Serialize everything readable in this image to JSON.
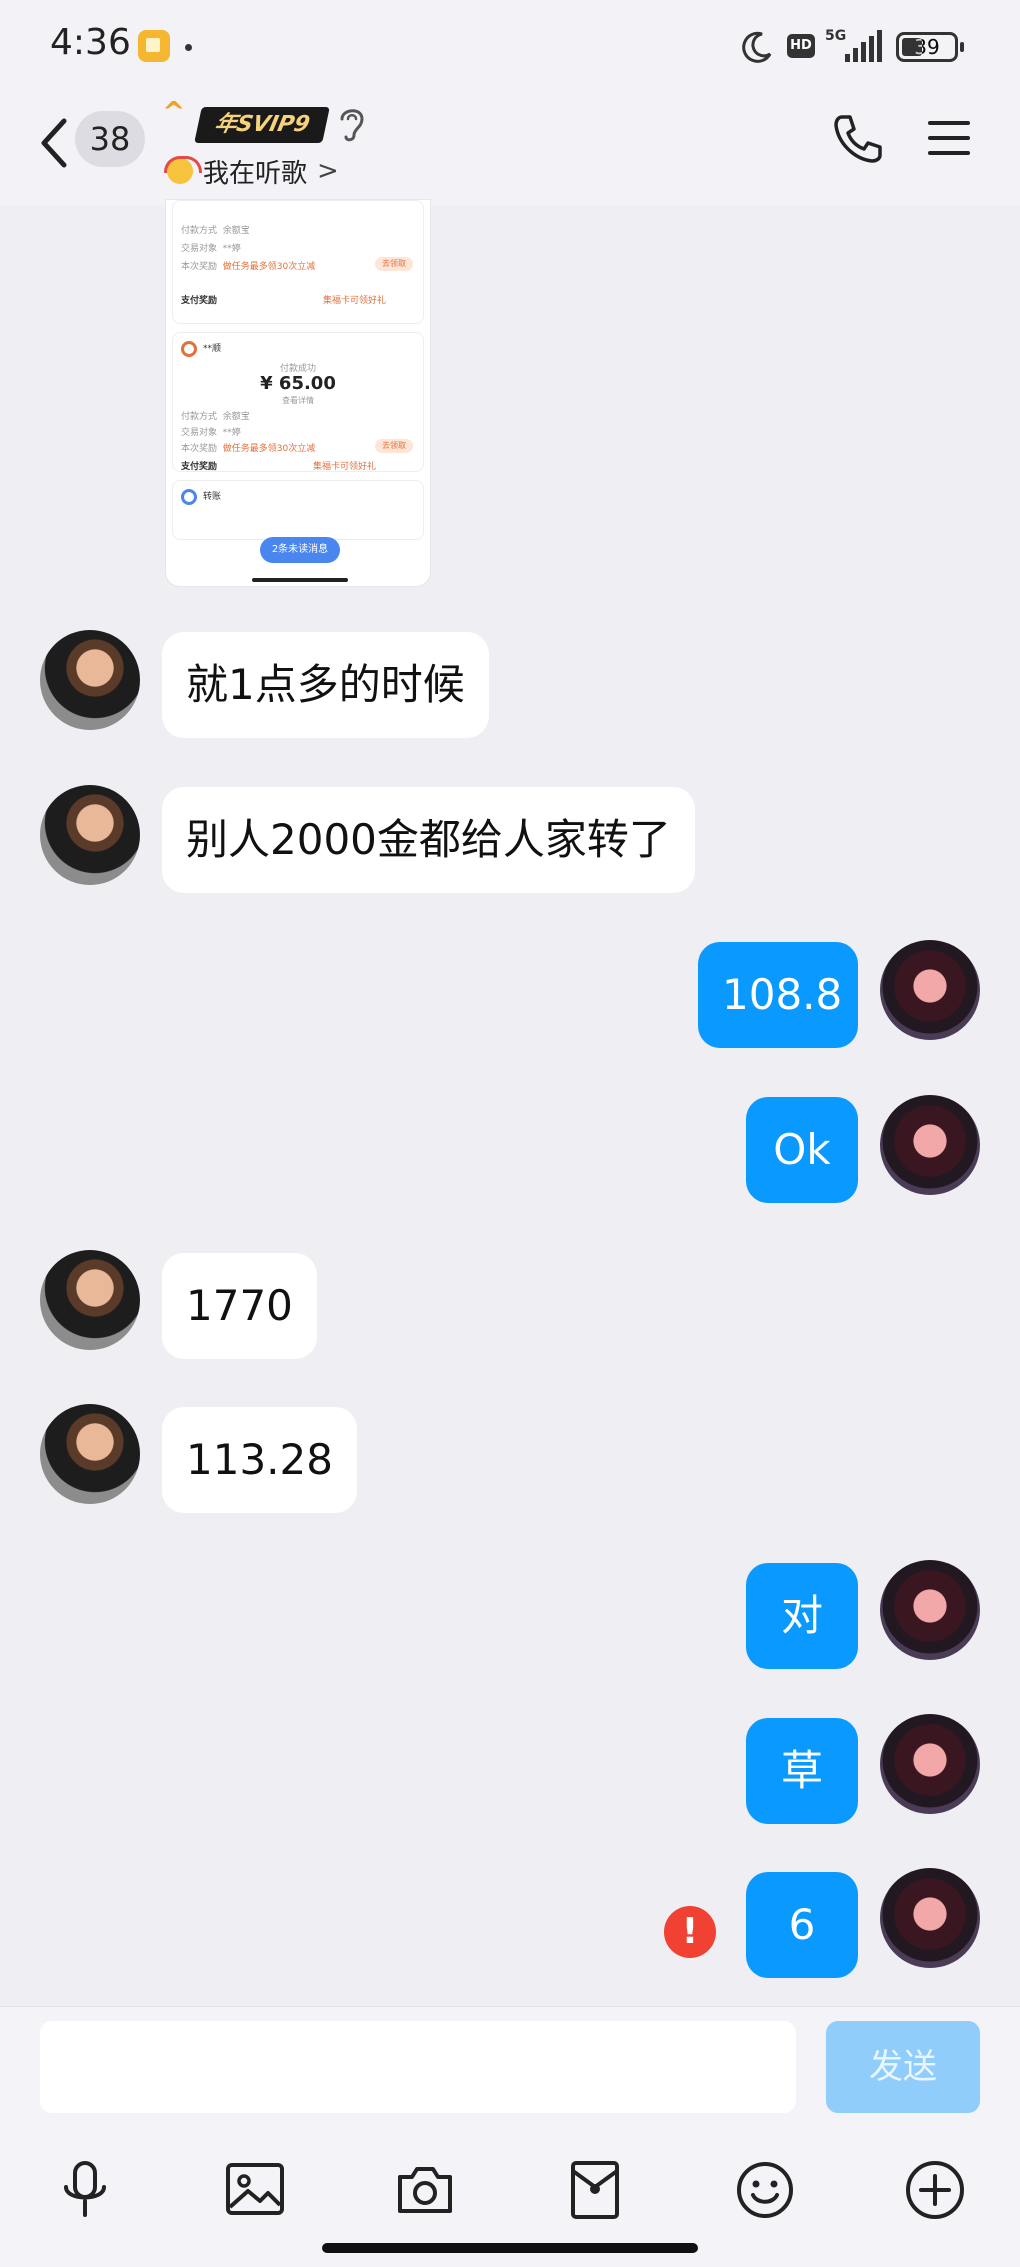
{
  "status_bar": {
    "time": "4:36",
    "network": "5G",
    "hd_label": "HD",
    "battery": "39",
    "battery_level": 0.39
  },
  "header": {
    "unread_count": "38",
    "caret": "^",
    "badge_text": "年SVIP9",
    "listening_status": "我在听歌",
    "chevron": ">"
  },
  "shared_image": {
    "labels": {
      "pay_method": "付款方式",
      "pay_method_value": "余额宝",
      "counterparty": "交易对象",
      "counterparty_value": "**婷",
      "reward": "本次奖励",
      "reward_value": "做任务最多领30次立减",
      "claim": "去领取",
      "pay_reward": "支付奖励",
      "pay_reward_link": "集福卡可领好礼",
      "merchant": "**顺",
      "pay_success": "付款成功",
      "amount": "¥ 65.00",
      "view_detail": "查看详情",
      "transfer": "转账",
      "unread_pill": "2条未读消息"
    }
  },
  "messages": [
    {
      "side": "in",
      "text": "就1点多的时候"
    },
    {
      "side": "in",
      "text": "别人2000金都给人家转了"
    },
    {
      "side": "out",
      "text": "108.8"
    },
    {
      "side": "out",
      "text": "Ok"
    },
    {
      "side": "in",
      "text": "1770"
    },
    {
      "side": "in",
      "text": "113.28"
    },
    {
      "side": "out",
      "text": "对"
    },
    {
      "side": "out",
      "text": "草"
    },
    {
      "side": "out",
      "text": "6",
      "failed": true
    }
  ],
  "error_mark": "!",
  "composer": {
    "input_value": "",
    "send_label": "发送"
  },
  "toolbar": [
    "microphone-icon",
    "image-icon",
    "camera-icon",
    "red-packet-icon",
    "emoji-icon",
    "plus-icon"
  ],
  "colors": {
    "outgoing_bubble": "#0a99ff",
    "incoming_bubble": "#ffffff",
    "send_disabled": "#90cdfb",
    "error": "#f04132",
    "background": "#eeeef3"
  }
}
